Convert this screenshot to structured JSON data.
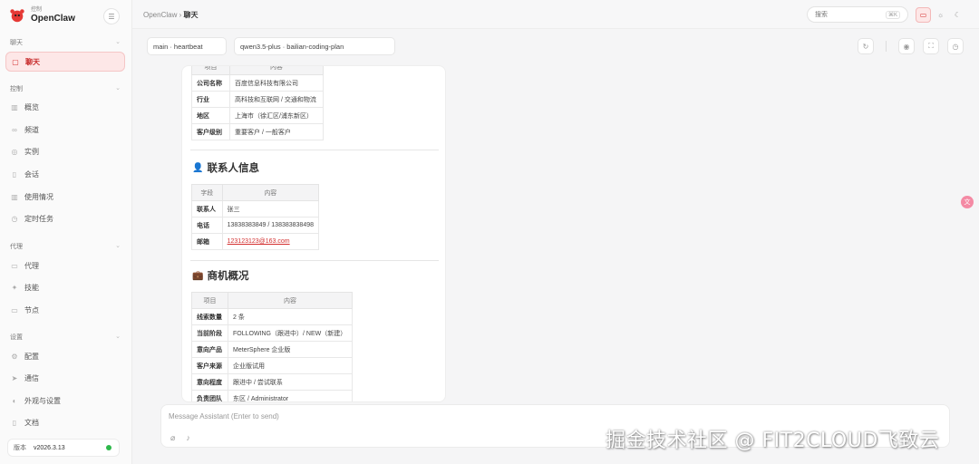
{
  "brand": {
    "sub": "控制",
    "name": "OpenClaw"
  },
  "sidebar": {
    "chat_group": "聊天",
    "chat_item": "聊天",
    "control_group": "控制",
    "control_items": [
      "概览",
      "频道",
      "实例",
      "会话",
      "使用情况",
      "定时任务"
    ],
    "agent_group": "代理",
    "agent_items": [
      "代理",
      "技能",
      "节点"
    ],
    "settings_group": "设置",
    "settings_items": [
      "配置",
      "通信",
      "外观与设置"
    ],
    "docs": "文档",
    "version_label": "版本",
    "version_value": "v2026.3.13"
  },
  "topbar": {
    "crumb_parent": "OpenClaw",
    "crumb_sep": "›",
    "crumb_current": "聊天",
    "search_placeholder": "搜索",
    "search_shortcut": "⌘K"
  },
  "controls": {
    "session": "main · heartbeat",
    "model": "qwen3.5-plus · bailian-coding-plan"
  },
  "message": {
    "company_table": {
      "headers": [
        "项目",
        "内容"
      ],
      "rows": [
        [
          "公司名称",
          "百度信息科技有限公司"
        ],
        [
          "行业",
          "高科技和互联网 / 交通和物流"
        ],
        [
          "地区",
          "上海市（徐汇区/浦东新区）"
        ],
        [
          "客户级别",
          "重要客户 / 一般客户"
        ]
      ]
    },
    "contact_heading": "联系人信息",
    "contact_table": {
      "headers": [
        "字段",
        "内容"
      ],
      "rows": [
        [
          "联系人",
          "张三"
        ],
        [
          "电话",
          "13838383849 / 13838383849​8"
        ],
        [
          "邮箱",
          "123123123@163.com"
        ]
      ]
    },
    "opportunity_heading": "商机概况",
    "opportunity_table": {
      "headers": [
        "项目",
        "内容"
      ],
      "rows": [
        [
          "线索数量",
          "2 条"
        ],
        [
          "当前阶段",
          "FOLLOWING（跟进中）/ NEW（新建）"
        ],
        [
          "意向产品",
          "MeterSphere 企业版"
        ],
        [
          "客户来源",
          "企业版试用"
        ],
        [
          "意向程度",
          "跟进中 / 尝试联系"
        ],
        [
          "负责团队",
          "东区 / Administrator"
        ]
      ]
    }
  },
  "composer": {
    "placeholder": "Message Assistant (Enter to send)"
  },
  "watermark": "掘金技术社区 @ FIT2CLOUD飞致云",
  "colors": {
    "accent": "#d32f2f",
    "status": "#2eb84b"
  }
}
